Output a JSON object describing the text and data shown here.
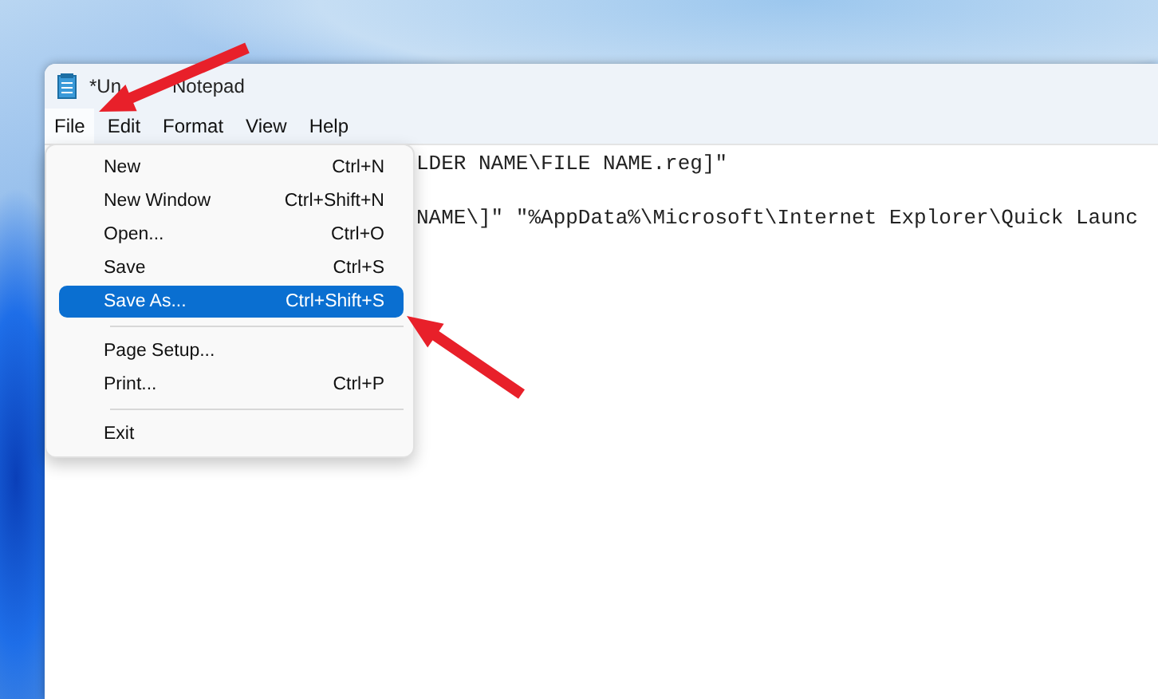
{
  "window": {
    "title_parts": [
      "*Un",
      "Notepad"
    ]
  },
  "menu_bar": [
    {
      "label": "File",
      "selected": true
    },
    {
      "label": "Edit",
      "selected": false
    },
    {
      "label": "Format",
      "selected": false
    },
    {
      "label": "View",
      "selected": false
    },
    {
      "label": "Help",
      "selected": false
    }
  ],
  "editor": {
    "lines": [
      "LDER NAME\\FILE NAME.reg]\"",
      "NAME\\]\" \"%AppData%\\Microsoft\\Internet Explorer\\Quick Launc"
    ]
  },
  "file_menu": [
    {
      "kind": "item",
      "label": "New",
      "shortcut": "Ctrl+N",
      "selected": false
    },
    {
      "kind": "item",
      "label": "New Window",
      "shortcut": "Ctrl+Shift+N",
      "selected": false
    },
    {
      "kind": "item",
      "label": "Open...",
      "shortcut": "Ctrl+O",
      "selected": false
    },
    {
      "kind": "item",
      "label": "Save",
      "shortcut": "Ctrl+S",
      "selected": false
    },
    {
      "kind": "item",
      "label": "Save As...",
      "shortcut": "Ctrl+Shift+S",
      "selected": true
    },
    {
      "kind": "separator"
    },
    {
      "kind": "item",
      "label": "Page Setup...",
      "selected": false
    },
    {
      "kind": "item",
      "label": "Print...",
      "shortcut": "Ctrl+P",
      "selected": false
    },
    {
      "kind": "separator"
    },
    {
      "kind": "item",
      "label": "Exit",
      "selected": false
    }
  ],
  "annotations": [
    {
      "kind": "arrow"
    },
    {
      "kind": "arrow"
    }
  ]
}
